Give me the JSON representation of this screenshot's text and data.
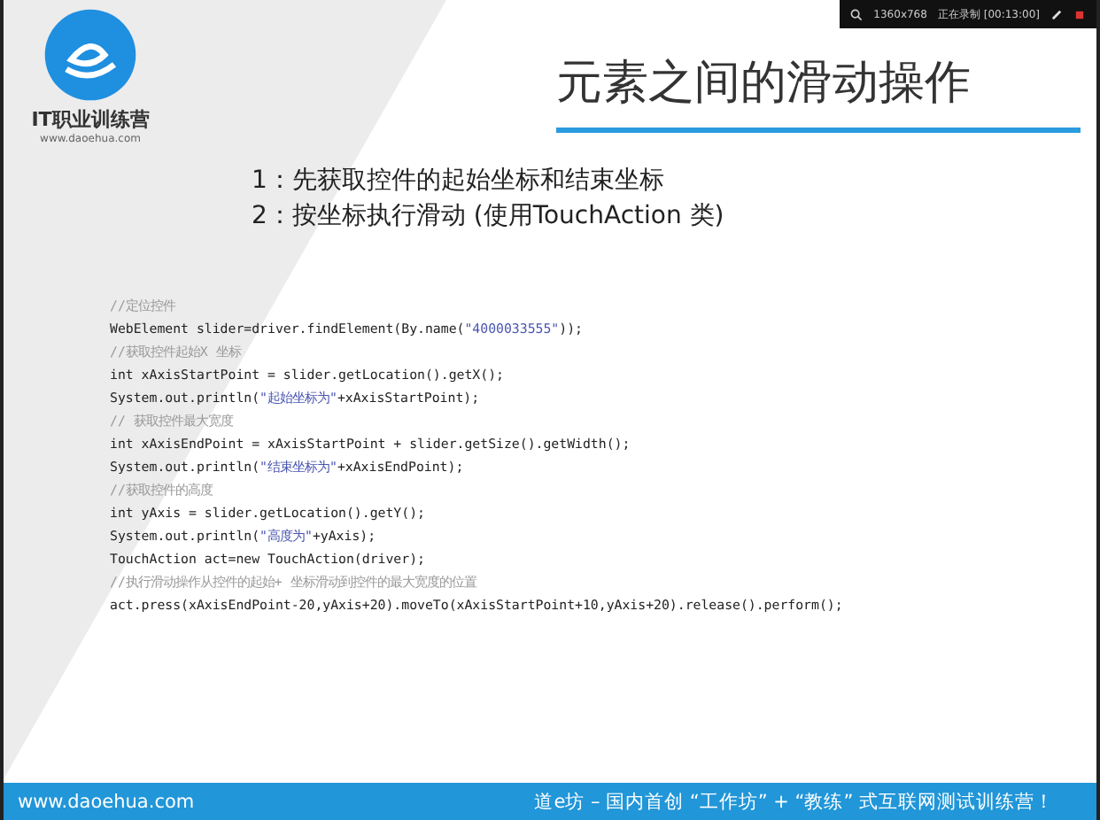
{
  "recorder_bar": {
    "resolution": "1360x768",
    "status": "正在录制 [00:13:00]"
  },
  "logo": {
    "name": "IT职业训练营",
    "url": "www.daoehua.com"
  },
  "title": "元素之间的滑动操作",
  "steps": [
    "1：先获取控件的起始坐标和结束坐标",
    "2：按坐标执行滑动 (使用TouchAction 类)"
  ],
  "code": [
    {
      "kind": "comment",
      "parts": [
        {
          "kind": "code",
          "text": "//定位控件"
        }
      ]
    },
    {
      "kind": "code",
      "parts": [
        {
          "kind": "code",
          "text": "WebElement slider=driver.findElement(By.name("
        },
        {
          "kind": "string",
          "text": "\"4000033555\""
        },
        {
          "kind": "code",
          "text": "));"
        }
      ]
    },
    {
      "kind": "comment",
      "parts": [
        {
          "kind": "code",
          "text": "//获取控件起始X 坐标"
        }
      ]
    },
    {
      "kind": "code",
      "parts": [
        {
          "kind": "code",
          "text": "int xAxisStartPoint = slider.getLocation().getX();"
        }
      ]
    },
    {
      "kind": "code",
      "parts": [
        {
          "kind": "code",
          "text": "System.out.println("
        },
        {
          "kind": "string",
          "text": "\"起始坐标为\""
        },
        {
          "kind": "code",
          "text": "+xAxisStartPoint);"
        }
      ]
    },
    {
      "kind": "comment",
      "parts": [
        {
          "kind": "code",
          "text": "// 获取控件最大宽度"
        }
      ]
    },
    {
      "kind": "code",
      "parts": [
        {
          "kind": "code",
          "text": "int xAxisEndPoint = xAxisStartPoint + slider.getSize().getWidth();"
        }
      ]
    },
    {
      "kind": "code",
      "parts": [
        {
          "kind": "code",
          "text": "System.out.println("
        },
        {
          "kind": "string",
          "text": "\"结束坐标为\""
        },
        {
          "kind": "code",
          "text": "+xAxisEndPoint);"
        }
      ]
    },
    {
      "kind": "comment",
      "parts": [
        {
          "kind": "code",
          "text": "//获取控件的高度"
        }
      ]
    },
    {
      "kind": "code",
      "parts": [
        {
          "kind": "code",
          "text": "int yAxis = slider.getLocation().getY();"
        }
      ]
    },
    {
      "kind": "code",
      "parts": [
        {
          "kind": "code",
          "text": "System.out.println("
        },
        {
          "kind": "string",
          "text": "\"高度为\""
        },
        {
          "kind": "code",
          "text": "+yAxis);"
        }
      ]
    },
    {
      "kind": "code",
      "parts": [
        {
          "kind": "code",
          "text": "TouchAction act=new TouchAction(driver);"
        }
      ]
    },
    {
      "kind": "comment",
      "parts": [
        {
          "kind": "code",
          "text": "//执行滑动操作从控件的起始+ 坐标滑动到控件的最大宽度的位置"
        }
      ]
    },
    {
      "kind": "code",
      "parts": [
        {
          "kind": "code",
          "text": "act.press(xAxisEndPoint-20,yAxis+20).moveTo(xAxisStartPoint+10,yAxis+20).release().perform();"
        }
      ]
    }
  ],
  "footer": {
    "url": "www.daoehua.com",
    "slogan": "道e坊 – 国内首创 “工作坊” + “教练” 式互联网测试训练营！"
  }
}
